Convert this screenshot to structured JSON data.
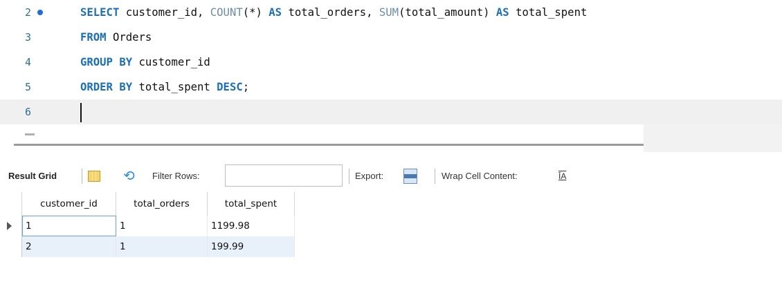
{
  "editor": {
    "lines": [
      {
        "number": "2",
        "tokens": [
          {
            "text": "SELECT",
            "kind": "kw"
          },
          {
            "text": " customer_id, ",
            "kind": "plain"
          },
          {
            "text": "COUNT",
            "kind": "fn"
          },
          {
            "text": "(*) ",
            "kind": "plain"
          },
          {
            "text": "AS",
            "kind": "kw"
          },
          {
            "text": " total_orders, ",
            "kind": "plain"
          },
          {
            "text": "SUM",
            "kind": "fn"
          },
          {
            "text": "(total_amount) ",
            "kind": "plain"
          },
          {
            "text": "AS",
            "kind": "kw"
          },
          {
            "text": " total_spent",
            "kind": "plain"
          }
        ]
      },
      {
        "number": "3",
        "tokens": [
          {
            "text": "FROM",
            "kind": "kw"
          },
          {
            "text": " Orders",
            "kind": "plain"
          }
        ]
      },
      {
        "number": "4",
        "tokens": [
          {
            "text": "GROUP BY",
            "kind": "kw"
          },
          {
            "text": " customer_id",
            "kind": "plain"
          }
        ]
      },
      {
        "number": "5",
        "tokens": [
          {
            "text": "ORDER BY",
            "kind": "kw"
          },
          {
            "text": " total_spent ",
            "kind": "plain"
          },
          {
            "text": "DESC",
            "kind": "kw"
          },
          {
            "text": ";",
            "kind": "plain"
          }
        ]
      },
      {
        "number": "6",
        "tokens": []
      }
    ],
    "colors": {
      "keyword": "#1a6fb5",
      "function": "#6a8da8",
      "line_number": "#2f6f8f",
      "exec_dot": "#1e6fd0",
      "current_line": "#f0f0f0"
    }
  },
  "toolbar": {
    "result_grid_label": "Result Grid",
    "grid_icon": "grid-view-icon",
    "refresh_icon": "refresh-icon",
    "filter_label": "Filter Rows:",
    "filter_value": "",
    "export_label": "Export:",
    "export_icon": "export-icon",
    "wrap_label": "Wrap Cell Content:",
    "wrap_icon_glyph": "ĪA",
    "wrap_icon": "wrap-text-icon"
  },
  "grid": {
    "columns": [
      "customer_id",
      "total_orders",
      "total_spent"
    ],
    "rows": [
      [
        "1",
        "1",
        "1199.98"
      ],
      [
        "2",
        "1",
        "199.99"
      ]
    ],
    "selected_row": 0,
    "colors": {
      "alt_row": "#e8f0fa",
      "selection_outline": "#6aa0e0"
    }
  }
}
